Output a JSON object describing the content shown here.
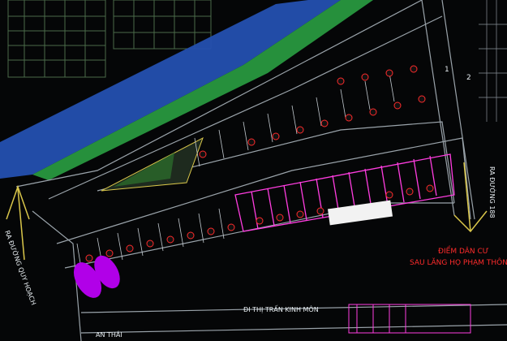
{
  "drawing": {
    "labels": {
      "road_north_top": "RA ĐƯỜNG QUY HOẠCH",
      "road_east": "RA ĐƯỜNG 188",
      "road_south": "ĐI THỊ TRẤN KINH MÔN",
      "road_southwest": "AN THÁI",
      "resettlement_1": "ĐIỂM DÂN CƯ",
      "resettlement_2": "SAU LĂNG HỌ PHẠM THÔN",
      "callout_1": "1",
      "callout_2": "2"
    },
    "colors": {
      "background": "#050607",
      "water": "#2450b0",
      "green": "#2aa043",
      "magenta": "#ff3de0",
      "red": "#ff2b2b",
      "grey_line": "#9aa3aa",
      "yellow": "#d9c64a"
    },
    "icons": {
      "north_arrow": "arrow-left-icon",
      "east_arrow": "arrow-down-icon",
      "plot_marker": "circle-tag-icon"
    }
  }
}
